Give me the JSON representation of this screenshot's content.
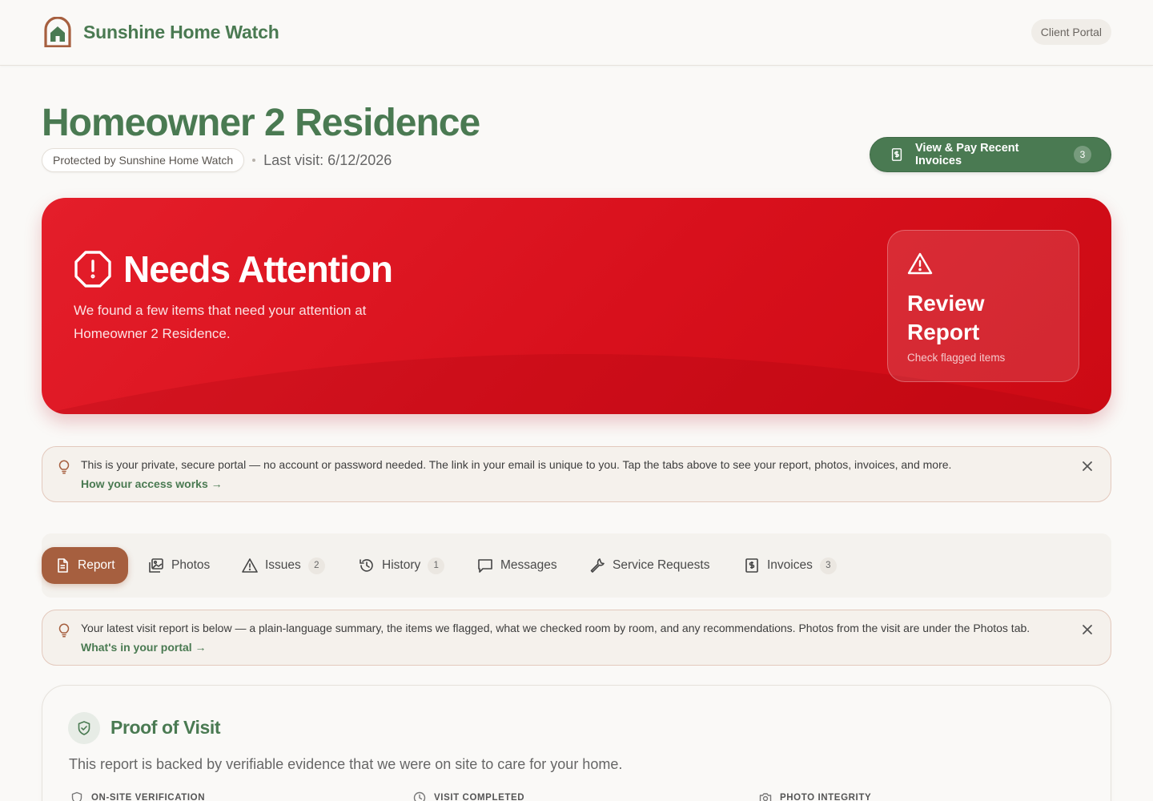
{
  "header": {
    "brand_name": "Sunshine Home Watch",
    "portal_label": "Client Portal"
  },
  "property": {
    "title": "Homeowner 2 Residence",
    "protected_label": "Protected by Sunshine Home Watch",
    "last_visit": "Last visit: 6/12/2026"
  },
  "invoice_button": {
    "label": "View & Pay Recent Invoices",
    "count": "3"
  },
  "status": {
    "title": "Needs Attention",
    "message": "We found a few items that need your attention at Homeowner 2 Residence.",
    "review_title": "Review Report",
    "review_subtitle": "Check flagged items",
    "color": "#e01a26"
  },
  "notice_access": {
    "message": "This is your private, secure portal — no account or password needed. The link in your email is unique to you. Tap the tabs above to see your report, photos, invoices, and more.",
    "link": "How your access works →"
  },
  "tabs": [
    {
      "label": "Report",
      "icon": "document-icon",
      "active": true
    },
    {
      "label": "Photos",
      "icon": "images-icon"
    },
    {
      "label": "Issues",
      "icon": "warning-icon",
      "count": "2"
    },
    {
      "label": "History",
      "icon": "history-icon",
      "count": "1"
    },
    {
      "label": "Messages",
      "icon": "chat-icon"
    },
    {
      "label": "Service Requests",
      "icon": "wrench-icon"
    },
    {
      "label": "Invoices",
      "icon": "invoice-icon",
      "count": "3"
    }
  ],
  "notice_report": {
    "message": "Your latest visit report is below — a plain-language summary, the items we flagged, what we checked room by room, and any recommendations. Photos from the visit are under the Photos tab.",
    "link": "What's in your portal →"
  },
  "proof": {
    "title": "Proof of Visit",
    "description": "This report is backed by verifiable evidence that we were on site to care for your home.",
    "stats": [
      {
        "label": "ON-SITE VERIFICATION",
        "icon": "shield-icon"
      },
      {
        "label": "VISIT COMPLETED",
        "icon": "clock-icon"
      },
      {
        "label": "PHOTO INTEGRITY",
        "icon": "camera-icon"
      }
    ]
  },
  "colors": {
    "brand_green": "#4a7a52",
    "accent_terracotta": "#a65f3f",
    "alert_red": "#e01a26"
  }
}
